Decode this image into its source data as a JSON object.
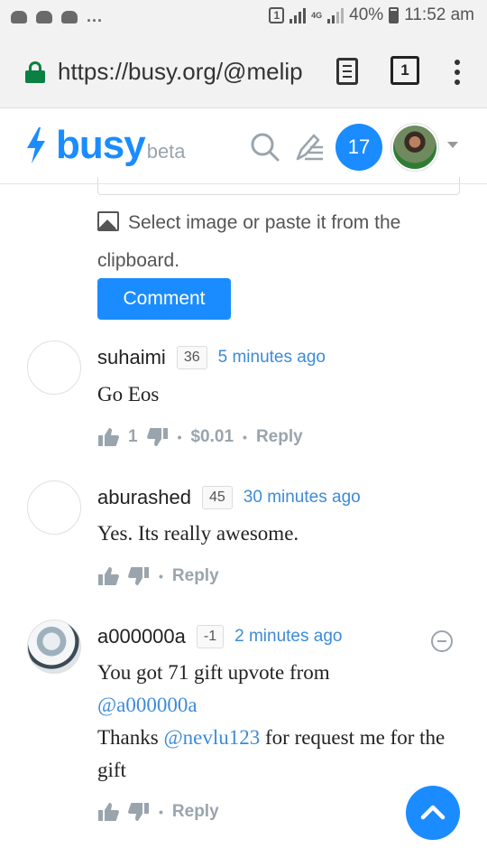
{
  "status_bar": {
    "sim_badge": "1",
    "network": "4G",
    "battery": "40%",
    "time": "11:52 am",
    "more": "..."
  },
  "browser": {
    "url": "https://busy.org/@melip",
    "tab_count": "1"
  },
  "header": {
    "logo": "busy",
    "logo_suffix": "beta",
    "notification_count": "17"
  },
  "editor": {
    "select_image_text": "Select image or paste it from the clipboard.",
    "comment_button": "Comment"
  },
  "comments": [
    {
      "author": "suhaimi",
      "reputation": "36",
      "time": "5 minutes ago",
      "body": "Go Eos",
      "likes": "1",
      "payout": "$0.01",
      "reply": "Reply"
    },
    {
      "author": "aburashed",
      "reputation": "45",
      "time": "30 minutes ago",
      "body": "Yes. Its really awesome.",
      "reply": "Reply"
    },
    {
      "author": "a000000a",
      "reputation": "-1",
      "time": "2 minutes ago",
      "body_line1": "You got 71 gift upvote from",
      "body_mention1": "@a000000a",
      "body_thanks": "Thanks",
      "body_mention2": "@nevlu123",
      "body_rest": "for request me for the gift",
      "reply": "Reply"
    }
  ],
  "colors": {
    "accent": "#1a8cff",
    "link": "#3d8bd8",
    "muted": "#9aa4ad"
  },
  "icons": [
    "lock-icon",
    "reader-mode-icon",
    "tabs-icon",
    "more-vert-icon",
    "bolt-icon",
    "search-icon",
    "write-icon",
    "image-icon",
    "thumb-up-icon",
    "thumb-down-icon",
    "collapse-icon",
    "chevron-up-icon"
  ]
}
